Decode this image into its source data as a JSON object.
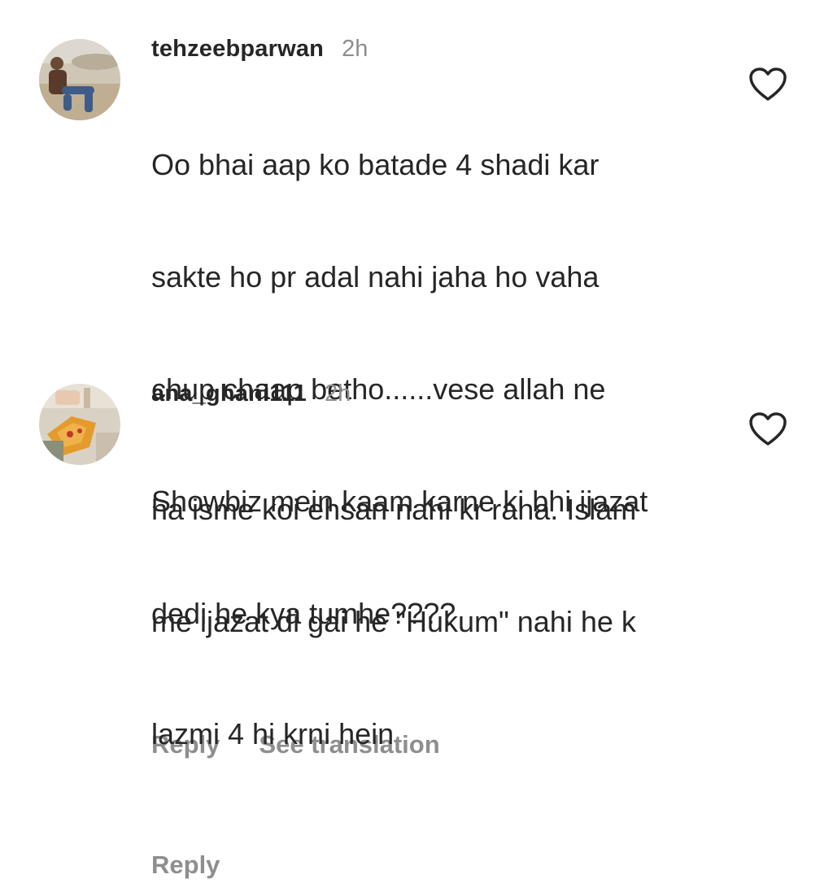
{
  "comments": [
    {
      "username": "tehzeebparwan",
      "time": "2h",
      "lines": [
        "Oo bhai aap ko batade 4 shadi kar",
        "sakte ho pr adal nahi jaha ho vaha",
        "chup chaap betho......vese allah ne",
        "Showbiz mein kaam karne ki bhi ijazat",
        "dedi he kya tumhe????"
      ],
      "reply_label": "Reply",
      "translate_label": "See translation",
      "like_icon": "heart-outline-icon"
    },
    {
      "username": "ana_ghani111",
      "time": "2h",
      "lines": [
        "ha isme koi ehsan nahi kr raha. Islam",
        "me ijazat di gai he \"Hukum\" nahi he k",
        "lazmi 4 hi krni hein"
      ],
      "reply_label": "Reply",
      "like_icon": "heart-outline-icon"
    }
  ],
  "colors": {
    "text": "#262626",
    "secondary": "#8e8e8e",
    "background": "#ffffff"
  }
}
